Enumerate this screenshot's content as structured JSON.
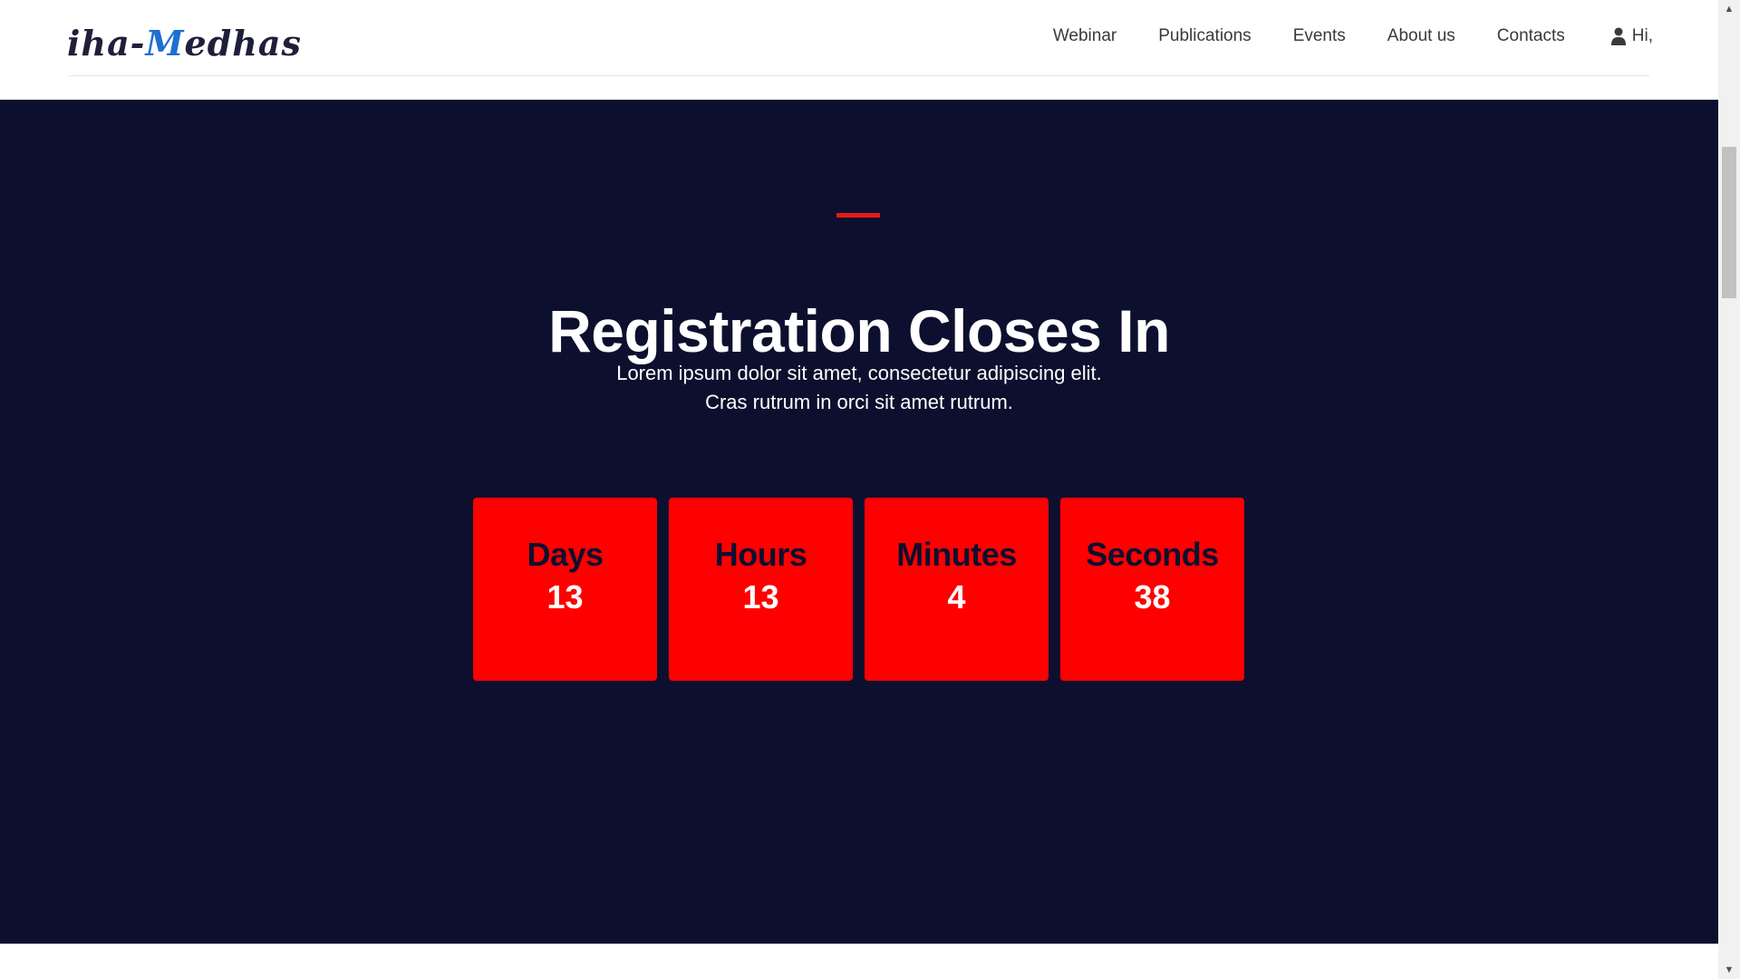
{
  "brand": {
    "logo_part1": "iha-",
    "logo_part2": "M",
    "logo_part3": "edhas"
  },
  "nav": {
    "items": [
      {
        "label": "Webinar"
      },
      {
        "label": "Publications"
      },
      {
        "label": "Events"
      },
      {
        "label": "About us"
      },
      {
        "label": "Contacts"
      }
    ],
    "user_label": "Hi,"
  },
  "hero": {
    "title": "Registration Closes In",
    "subtitle_line1": "Lorem ipsum dolor sit amet, consectetur adipiscing elit.",
    "subtitle_line2": "Cras rutrum in orci sit amet rutrum."
  },
  "countdown": [
    {
      "label": "Days",
      "value": "13"
    },
    {
      "label": "Hours",
      "value": "13"
    },
    {
      "label": "Minutes",
      "value": "4"
    },
    {
      "label": "Seconds",
      "value": "38"
    }
  ],
  "colors": {
    "hero_background": "#0d0f2e",
    "accent_red": "#ff0000",
    "logo_accent": "#1d6fd1"
  },
  "icons": {
    "user": "user-icon",
    "scroll_up": "scroll-up-arrow-icon",
    "scroll_down": "scroll-down-arrow-icon"
  }
}
